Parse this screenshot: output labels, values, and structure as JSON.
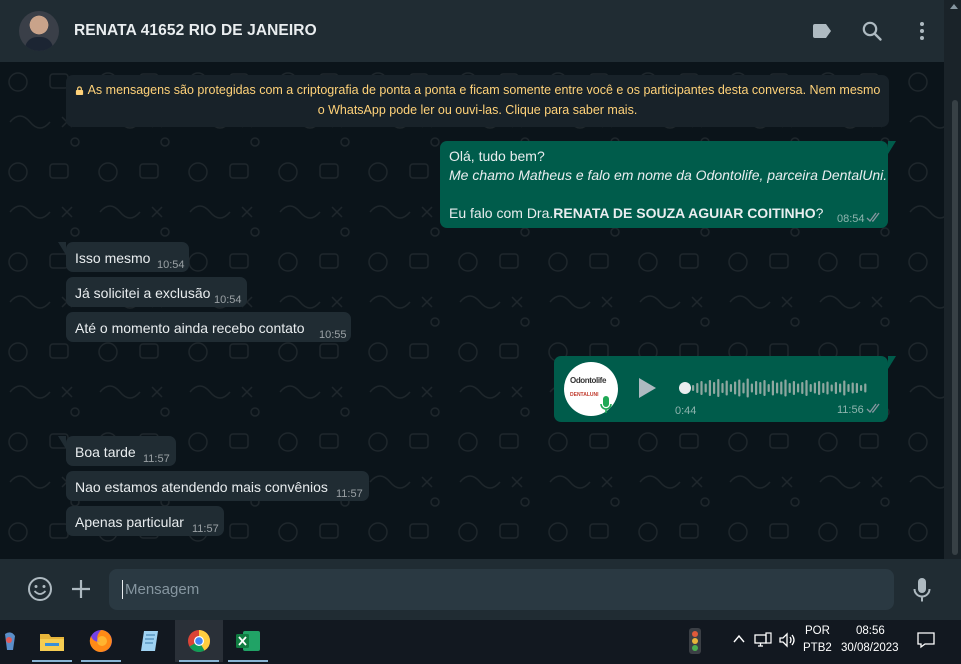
{
  "header": {
    "contact_name": "RENATA 41652 RIO DE JANEIRO",
    "icons": [
      "label-icon",
      "search-icon",
      "menu-dots-icon"
    ]
  },
  "encryption_notice": {
    "line1": "As mensagens são protegidas com a criptografia de ponta a ponta e ficam somente entre você e os participantes desta conversa. Nem mesmo",
    "line2": "o WhatsApp pode ler ou ouvi-las. Clique para saber mais."
  },
  "messages": {
    "out1": {
      "line1": "Olá, tudo bem?",
      "line2": "Me chamo Matheus e falo em nome da Odontolife, parceira DentalUni.",
      "line3_prefix": "Eu falo com Dra.",
      "line3_bold": "RENATA DE SOUZA AGUIAR COITINHO",
      "line3_suffix": "?",
      "time": "08:54"
    },
    "in1": {
      "text": "Isso mesmo",
      "time": "10:54"
    },
    "in2": {
      "text": "Já solicitei a exclusão",
      "time": "10:54"
    },
    "in3": {
      "text": "Até o momento ainda recebo contato",
      "time": "10:55"
    },
    "voice": {
      "duration": "0:44",
      "time": "11:56",
      "avatar_text": "Odontolife",
      "avatar_subtext": "DENTALUNI"
    },
    "in4": {
      "text": "Boa tarde",
      "time": "11:57"
    },
    "in5": {
      "text": "Nao estamos atendendo mais convênios",
      "time": "11:57"
    },
    "in6": {
      "text": "Apenas particular",
      "time": "11:57"
    }
  },
  "composer": {
    "placeholder": "Mensagem"
  },
  "taskbar": {
    "lang_line1": "POR",
    "lang_line2": "PTB2",
    "time": "08:56",
    "date": "30/08/2023"
  },
  "colors": {
    "header_bg": "#202c33",
    "chat_bg": "#0b141a",
    "incoming_bubble": "#202c33",
    "outgoing_bubble": "#005c4b",
    "notice_text": "#ffd279",
    "icon_gray": "#aebac1",
    "tick_color": "#8696a0"
  }
}
